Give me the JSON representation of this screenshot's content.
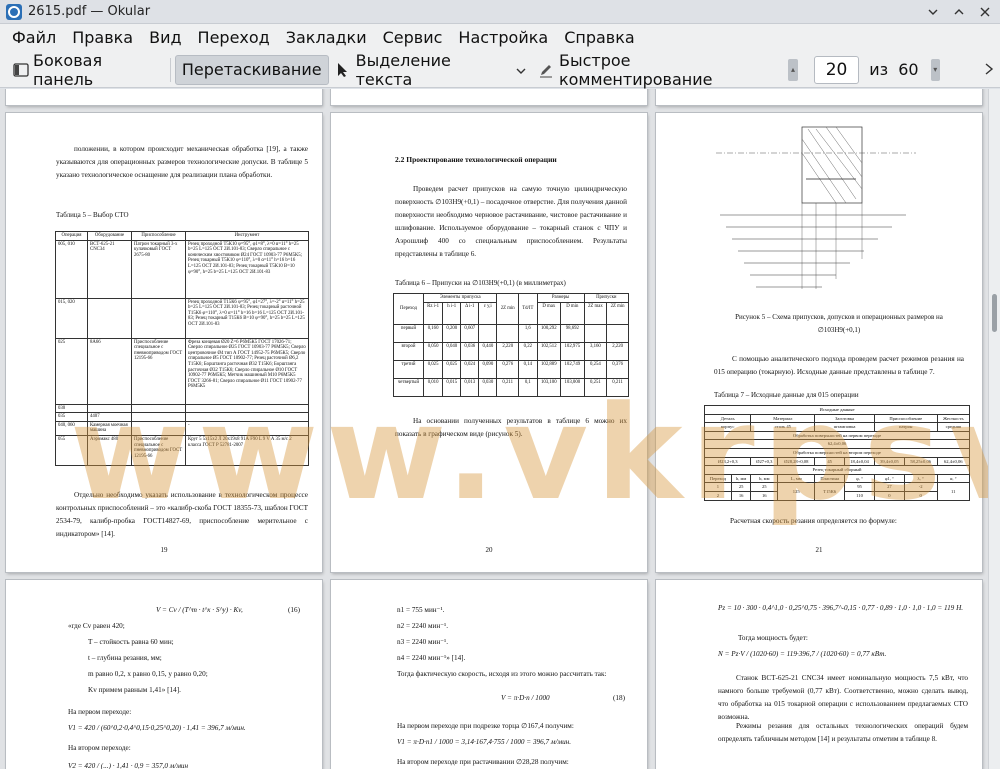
{
  "window": {
    "title": "2615.pdf — Okular"
  },
  "menu": [
    "Файл",
    "Правка",
    "Вид",
    "Переход",
    "Закладки",
    "Сервис",
    "Настройка",
    "Справка"
  ],
  "toolbar": {
    "sidebar": "Боковая панель",
    "drag": "Перетаскивание",
    "text_select": "Выделение текста",
    "quick_comment": "Быстрое комментирование",
    "page_current": "20",
    "page_of": "из",
    "page_total": "60"
  },
  "watermark": "www.vkrpsv.ru",
  "pages": {
    "p19": {
      "para1": "положении, в котором происходит механическая обработка [19], а также указываются для операционных размеров технологические допуски. В таблице 5 указано технологическое оснащение для реализации плана обработки.",
      "table_caption": "Таблица 5 – Выбор СТО",
      "headers": [
        "Операция",
        "Оборудование",
        "Приспособление",
        "Инструмент"
      ],
      "rows": [
        [
          "005, 010",
          "ВСТ-625-21 CNC34",
          "Патрон токарный 3-х кулачковый ГОСТ 2675-80",
          "Резец проходной Т5К10 φ=95°, φ1=8°, λ=0 α=11° h=25 b=25 L=125 ОСТ 2И.101-83; Сверло спиральное с коническим хвостовиком Ø24 ГОСТ 10903-77 Р6М5К5; Резец токарный Т5К10 φ=110°, λ=0 α=11° h=16 b=16 L=125 ОСТ 2И.101-83; Резец токарный Т5К10 В=10 φ=90°, h=25 b=25 L=125 ОСТ 2И.101-83"
        ],
        [
          "015, 020",
          "",
          "",
          "Резец проходной Т15К6 φ=95°, φ1=27°, λ=-2° α=11° h=25 b=25 L=125 ОСТ 2И.101-83; Резец токарный расточной Т15К6 φ=110°, λ=0 α=11° h=16 b=16 L=125 ОСТ 2И.101-83; Резец токарный Т15К6 В=10 φ=90°, h=25 b=25 L=125 ОСТ 2И.101-83"
        ],
        [
          "025",
          "8А66",
          "Приспособление специальное с пневмоприводом ГОСТ 12195-66",
          "Фреза концевая Ø20 Z=6 Р6М5К5 ГОСТ 17026-71; Сверло спиральное Ø25 ГОСТ 10903-77 Р6М5К5; Сверло центровочное Ø4 тип А ГОСТ 14952-75 Р6М5К5; Сверло спиральное Ø5 ГОСТ 10902-77; Резец расточной Ø6,2 Т15К6; Борштанга расточная Ø32 Т15К6; Борштанга расточная Ø32 Т15К6; Сверло спиральное Ø10 ГОСТ 10902-77 Р6М5К5; Метчик машинный М10 Р6М5К5 ГОСТ 3266-81; Сверло спиральное Ø11 ГОСТ 10902-77 Р6М5К5"
        ],
        [
          "030",
          "",
          "",
          ""
        ],
        [
          "035",
          "4407",
          "",
          ""
        ],
        [
          "040, 060",
          "Камерная моечная машина",
          "",
          "-"
        ],
        [
          "055",
          "Аэромакс 480",
          "Приспособление специальное с пневмоприводом ГОСТ 12195-66",
          "Круг 5 5x15x2 Л 20x19x8 91А F90 L 9 V А 35 м/с 2 класса ГОСТ Р 52781-2007"
        ]
      ],
      "para2": "Отдельно необходимо указать использование в технологическом процессе контрольных приспособлений – это «калибр-скоба ГОСТ 18355-73, шаблон ГОСТ 2534-79, калибр-пробка ГОСТ14827-69, приспособление мерительное с индикатором» [14].",
      "num": "19"
    },
    "p20": {
      "heading": "2.2 Проектирование технологической операции",
      "para1": "Проведем расчет припусков на самую точную цилиндрическую поверхность ∅103H9(+0,1) – посадочное отверстие. Для получения данной поверхности необходимо черновое растачивание, чистовое растачивание и шлифование. Используемое оборудование – токарный станок с ЧПУ и Аэрошлиф 400 со специальным приспособлением. Результаты представлены в таблице 6.",
      "table_caption": "Таблица 6 – Припуски на ∅103H9(+0,1) (в миллиметрах)",
      "table_headers": [
        "Переход",
        "Элементы припуска",
        "2Z min",
        "Td/IT",
        "Размеры",
        "Припуски"
      ],
      "table_sub": [
        "Rz i-1",
        "h i-1",
        "Δ i-1",
        "ε y,i",
        "D max",
        "D min",
        "2Z max",
        "2Z min"
      ],
      "rows": [
        [
          "первый",
          "0,160",
          "0,200",
          "0,607",
          "",
          "",
          "1,6",
          "100,292",
          "98,692",
          "",
          ""
        ],
        [
          "второй",
          "0,050",
          "0,040",
          "0,036",
          "0,440",
          "2,220",
          "0,22",
          "102,512",
          "102,975",
          "3,160",
          "2,220"
        ],
        [
          "третий",
          "0,025",
          "0,025",
          "0,024",
          "0,090",
          "0,276",
          "0,14",
          "102,889",
          "102,749",
          "0,254",
          "0,376"
        ],
        [
          "четвертый",
          "0,010",
          "0,015",
          "0,013",
          "0,030",
          "0,211",
          "0,1",
          "103,100",
          "103,000",
          "0,251",
          "0,211"
        ]
      ],
      "para2": "На основании полученных результатов в таблице 6 можно их показать в графическом виде (рисунок 5).",
      "num": "20"
    },
    "p21": {
      "fig_caption": "Рисунок 5 – Схема припусков, допусков и операционных размеров на ∅103H9(+0,1)",
      "para1": "С помощью аналитического подхода проведем расчет режимов резания на 015 операцию (токарную). Исходные данные представлены в таблице 7.",
      "table_caption": "Таблица 7 – Исходные данные для 015 операции",
      "t_title": "Исходные данные",
      "t_h1": [
        "Деталь",
        "Материал",
        "Заготовка",
        "Приспособление",
        "Жесткость"
      ],
      "t_r1": [
        "корпус",
        "сталь 45",
        "штамповка",
        "патрон",
        "средняя"
      ],
      "t_title2": "Обработка поверхностей на первом переходе",
      "t_val2": "62,4±0,06",
      "t_title3": "Обработка поверхностей на втором переходе",
      "t_r3": [
        "Ø23,2+0,3",
        "Ø27+0,3",
        "Ø28,28+0,08",
        "45",
        "18,4±0,04",
        "39,4±0,05",
        "58,25±0,06",
        "62,4±0,06"
      ],
      "t_title4": "Резец токарный сборный",
      "t_h4": [
        "Переход",
        "h, мм",
        "b, мм",
        "L, мм",
        "Пластина",
        "φ, °",
        "φ1, °",
        "λ, °",
        "α, °"
      ],
      "t_rows4": [
        [
          "1",
          "25",
          "25",
          "125",
          "Т15К6",
          "95",
          "27",
          "-2",
          "11"
        ],
        [
          "2",
          "16",
          "16",
          "",
          "",
          "110",
          "0",
          "0",
          ""
        ]
      ],
      "para2": "Расчетная скорость резания определяется по формуле:",
      "num": "21"
    },
    "p22": {
      "formula": "V = Cv / (T^m · t^x · S^y) · Kv,",
      "formula_num": "(16)",
      "lines": [
        "«где Cv равен 420;",
        "T – стойкость равна 60 мин;",
        "t – глубина резания, мм;",
        "m равно 0,2, x равно 0,15, y равно 0,20;",
        "Kv примем равным 1,41» [14].",
        "На первом переходе:",
        "V1 = 420 / (60^0,2·0,4^0,15·0,25^0,20) · 1,41 = 396,7 м/мин.",
        "На втором переходе:",
        "V2 = 420 / (...) · 1,41 · 0,9 = 357,0 м/мин"
      ]
    },
    "p23": {
      "lines": [
        "n1 = 755 мин⁻¹.",
        "n2 = 2240 мин⁻¹.",
        "n3 = 2240 мин⁻¹.",
        "n4 = 2240 мин⁻¹» [14].",
        "Тогда фактическую скорость, исходя из этого можно рассчитать так:"
      ],
      "formula": "V = π·D·n / 1000",
      "formula_num": "(18)",
      "lines2": [
        "На первом переходе при подрезке торца ∅167,4 получим:",
        "V1 = π·D·n1 / 1000 = 3,14·167,4·755 / 1000 = 396,7 м/мин.",
        "На втором переходе при растачивании ∅28,28 получим:"
      ]
    },
    "p24": {
      "lines": [
        "Pz = 10 · 300 · 0,4^1,0 · 0,25^0,75 · 396,7^-0,15 · 0,77 · 0,89 · 1,0 · 1,0 · 1,0 = 119 Н.",
        "Тогда мощность будет:",
        "N = Pz·V / (1020·60) = 119·396,7 / (1020·60) = 0,77 кВт.",
        "Станок ВСТ-625-21 CNC34 имеет номинальную мощность 7,5 кВт, что намного больше требуемой (0,77 кВт). Соответственно, можно сделать вывод, что обработка на 015 токарной операции с использованием предлагаемых СТО возможна.",
        "Режимы резания для остальных технологических операций будем определять табличным методом [14] и результаты отметим в таблице 8."
      ]
    }
  }
}
